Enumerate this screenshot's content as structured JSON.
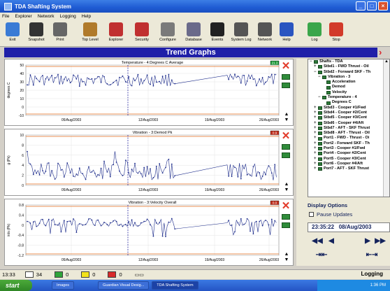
{
  "window": {
    "title": "TDA Shafting System"
  },
  "menu": [
    "File",
    "Explorer",
    "Network",
    "Logging",
    "Help"
  ],
  "toolbar": [
    {
      "label": "Exit",
      "icon": "exit-icon",
      "color": "#3a7bd5"
    },
    {
      "label": "Snapshot",
      "icon": "camera-icon",
      "color": "#333333"
    },
    {
      "label": "Print",
      "icon": "printer-icon",
      "color": "#666666"
    },
    {
      "label": "Top Level",
      "icon": "building-icon",
      "color": "#b07a2a"
    },
    {
      "label": "Explorer",
      "icon": "network-icon",
      "color": "#c03030"
    },
    {
      "label": "Security",
      "icon": "key-icon",
      "color": "#c03030"
    },
    {
      "label": "Configure",
      "icon": "configure-icon",
      "color": "#7a7a7a"
    },
    {
      "label": "Database",
      "icon": "database-icon",
      "color": "#6a6a8a"
    },
    {
      "label": "Events",
      "icon": "traffic-light-icon",
      "color": "#222222"
    },
    {
      "label": "System Log",
      "icon": "log-icon",
      "color": "#555555"
    },
    {
      "label": "Network",
      "icon": "network-grid-icon",
      "color": "#555555"
    },
    {
      "label": "Help",
      "icon": "help-icon",
      "color": "#2a55c0"
    },
    {
      "label": "Log",
      "icon": "log-start-icon",
      "color": "#3aa64a"
    },
    {
      "label": "Stop",
      "icon": "stop-icon",
      "color": "#d23a2a"
    }
  ],
  "banner": {
    "title": "Trend Graphs"
  },
  "graphs": [
    {
      "title": "Temperature - 4:Degrees C Average",
      "ylabel": "degrees C",
      "badge": "21.3",
      "badge_color": "#1f9a3a",
      "yticks": [
        "50",
        "40",
        "30",
        "20",
        "10",
        "0",
        "-10"
      ],
      "xticks": [
        "05/Aug/2003",
        "12/Aug/2003",
        "19/Aug/2003",
        "26/Aug/2003"
      ],
      "series_color": "#1f2e8c",
      "limit_color": "#e06a1a"
    },
    {
      "title": "Vibration - 3:Demod Pk",
      "ylabel": "g (Pk)",
      "badge": "0.9",
      "badge_color": "#c0301e",
      "yticks": [
        "10",
        "8",
        "6",
        "4",
        "2",
        "0"
      ],
      "xticks": [
        "05/Aug/2003",
        "12/Aug/2003",
        "19/Aug/2003",
        "26/Aug/2003"
      ],
      "series_color": "#1f2e8c",
      "limit_color": "#e06a1a"
    },
    {
      "title": "Vibration - 3:Velocity Overall",
      "ylabel": "in/s (Pk)",
      "badge": "0.0",
      "badge_color": "#c0301e",
      "yticks": [
        "0.8",
        "0.4",
        "0",
        "-0.4",
        "-0.8",
        "-1.2"
      ],
      "xticks": [
        "05/Aug/2003",
        "12/Aug/2003",
        "19/Aug/2003",
        "26/Aug/2003"
      ],
      "series_color": "#1f2e8c",
      "limit_color": "#e06a1a"
    }
  ],
  "tree": [
    {
      "label": "Shafts - TDA",
      "indent": 0,
      "expander": "-"
    },
    {
      "label": "Stbd1 - FWD Thrust - Oil",
      "indent": 1,
      "expander": "+"
    },
    {
      "label": "Stbd2 - Forward SKF - Th",
      "indent": 1,
      "expander": "-"
    },
    {
      "label": "Vibration - 3",
      "indent": 2,
      "expander": "-"
    },
    {
      "label": "Acceleration",
      "indent": 3,
      "expander": ""
    },
    {
      "label": "Demod",
      "indent": 3,
      "expander": ""
    },
    {
      "label": "Velocity",
      "indent": 3,
      "expander": ""
    },
    {
      "label": "Temperature - 4",
      "indent": 2,
      "expander": "-"
    },
    {
      "label": "Degrees C",
      "indent": 3,
      "expander": ""
    },
    {
      "label": "Stbd3 - Cooper #1/Fwd",
      "indent": 1,
      "expander": "+"
    },
    {
      "label": "Stbd4 - Cooper #2/Cent",
      "indent": 1,
      "expander": "+"
    },
    {
      "label": "Stbd5 - Cooper #3/Cent",
      "indent": 1,
      "expander": "+"
    },
    {
      "label": "Stbd6 - Cooper #4/Aft",
      "indent": 1,
      "expander": "+"
    },
    {
      "label": "Stbd7 - AFT - SKF Thrust",
      "indent": 1,
      "expander": "+"
    },
    {
      "label": "Stbd8 - AFT - Thrust - Oil",
      "indent": 1,
      "expander": "+"
    },
    {
      "label": "Port1 - FWD - Thrust - Oi",
      "indent": 1,
      "expander": "+"
    },
    {
      "label": "Port2 - Forward SKF - Th",
      "indent": 1,
      "expander": "+"
    },
    {
      "label": "Port3 - Cooper #1/Fwd",
      "indent": 1,
      "expander": "+"
    },
    {
      "label": "Port4 - Cooper #2/Cent",
      "indent": 1,
      "expander": "+"
    },
    {
      "label": "Port5 - Cooper #3/Cent",
      "indent": 1,
      "expander": "+"
    },
    {
      "label": "Port6 - Cooper #4/Aft",
      "indent": 1,
      "expander": "+"
    },
    {
      "label": "Port7 - AFT - SKF Thrust",
      "indent": 1,
      "expander": "+"
    }
  ],
  "display": {
    "title": "Display Options",
    "pause_label": "Pause Updates",
    "time": "23:35:22",
    "date": "08/Aug/2003"
  },
  "status": {
    "time": "13:33",
    "counts": [
      {
        "value": "34",
        "color": "#ffffff"
      },
      {
        "value": "0",
        "color": "#2fa43a"
      },
      {
        "value": "0",
        "color": "#f3e21a"
      },
      {
        "value": "0",
        "color": "#d82a2a"
      }
    ],
    "mode": "Logging"
  },
  "taskbar": {
    "start": "start",
    "tasks": [
      "Images",
      "Guardian Visual Desig...",
      "TDA Shafting System"
    ],
    "clock": "1:36 PM"
  }
}
